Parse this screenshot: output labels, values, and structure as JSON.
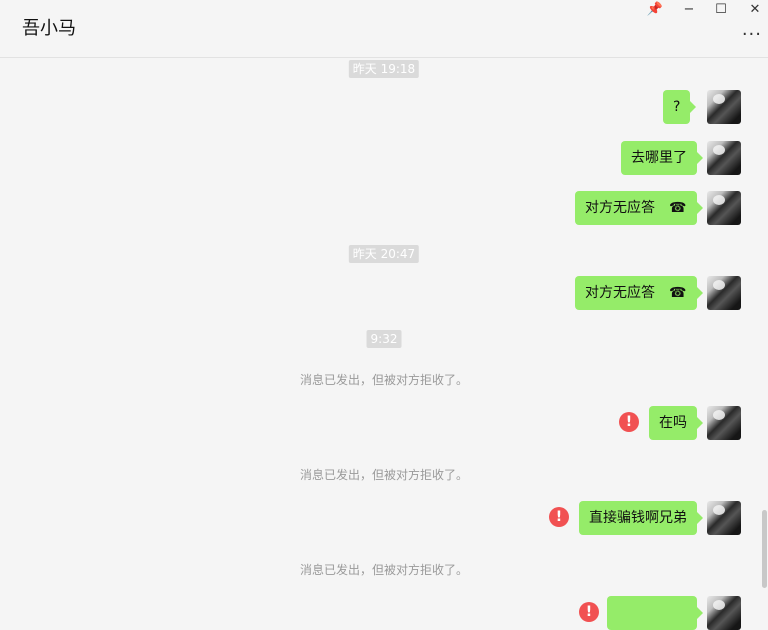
{
  "header": {
    "title": "吾小马",
    "pin_icon": "📌",
    "minimize": "−",
    "maximize": "☐",
    "close": "✕",
    "more": "···"
  },
  "messages": {
    "t1": "昨天 19:18",
    "m1": "?",
    "m2": "去哪里了",
    "m3": "对方无应答",
    "t2": "昨天 20:47",
    "m4": "对方无应答",
    "t3": "9:32",
    "s1": "消息已发出，但被对方拒收了。",
    "m5": "在吗",
    "s2": "消息已发出，但被对方拒收了。",
    "m6": "直接骗钱啊兄弟",
    "s3": "消息已发出，但被对方拒收了。",
    "error_mark": "!",
    "call_icon": "☎"
  },
  "colors": {
    "bubble_self": "#95ec69",
    "error": "#f15152",
    "timestamp_bg": "#dadada"
  }
}
